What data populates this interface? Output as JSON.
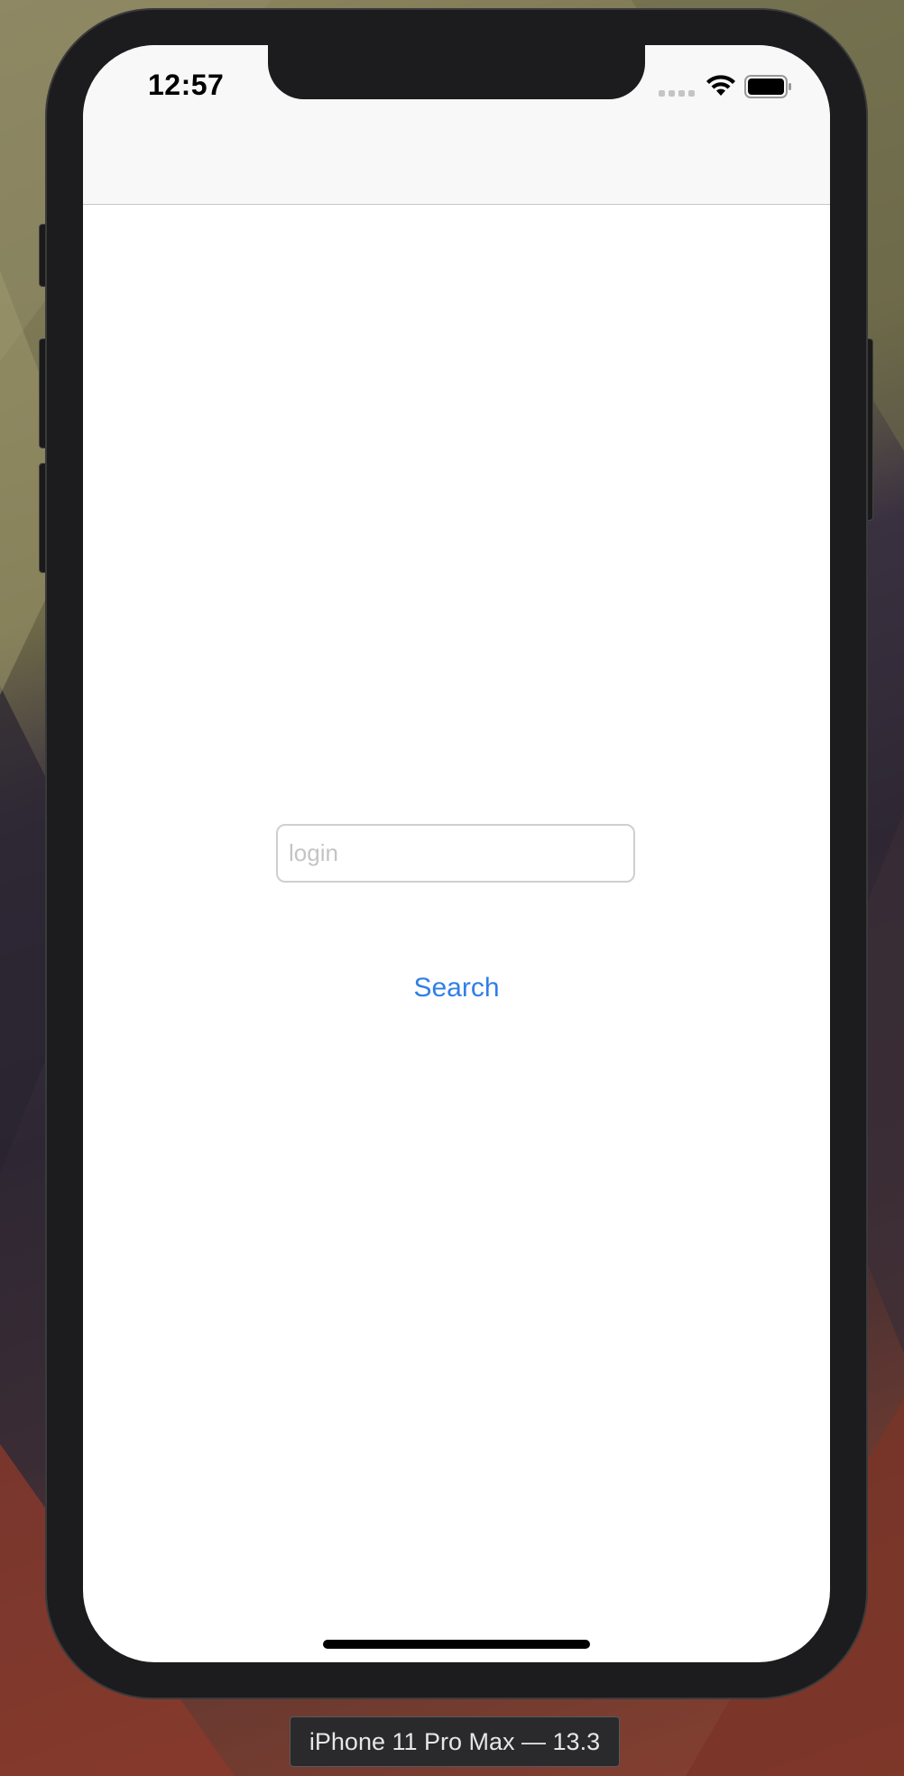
{
  "status_bar": {
    "time": "12:57",
    "signal_icon": "cellular-signal-icon",
    "wifi_icon": "wifi-icon",
    "battery_icon": "battery-icon"
  },
  "form": {
    "login_placeholder": "login",
    "login_value": "",
    "search_label": "Search"
  },
  "simulator": {
    "device_label": "iPhone 11 Pro Max — 13.3"
  },
  "colors": {
    "accent": "#2f7fe6",
    "nav_background": "#f8f8f8",
    "device_frame": "#1c1c1e"
  }
}
